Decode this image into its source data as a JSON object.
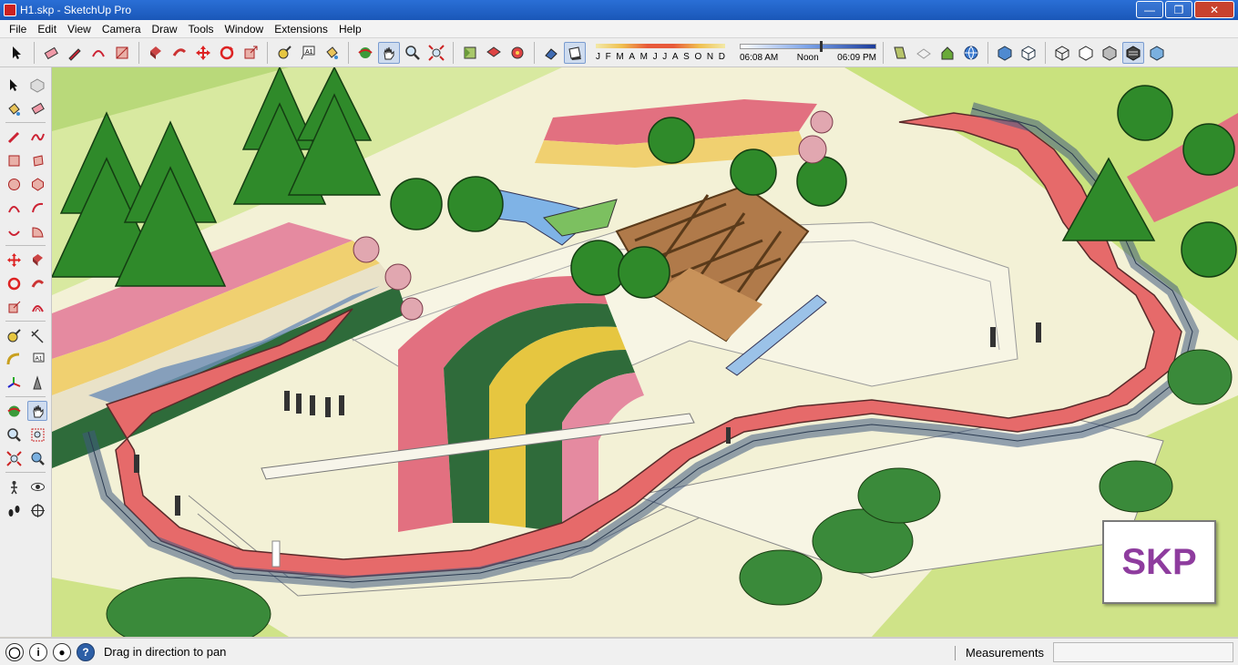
{
  "window": {
    "title": "H1.skp - SketchUp Pro",
    "controls": {
      "minimize": "—",
      "maximize": "❐",
      "close": "✕"
    }
  },
  "menu": {
    "items": [
      "File",
      "Edit",
      "View",
      "Camera",
      "Draw",
      "Tools",
      "Window",
      "Extensions",
      "Help"
    ]
  },
  "toolbar": {
    "icons": [
      "select-icon",
      "eraser-icon",
      "pencil-icon",
      "arc-icon",
      "rectangle-icon",
      "push-pull-icon",
      "follow-me-icon",
      "move-icon",
      "rotate-icon",
      "scale-icon",
      "tape-measure-icon",
      "text-icon",
      "paint-bucket-icon",
      "orbit-icon",
      "pan-icon",
      "zoom-icon",
      "zoom-extents-icon",
      "warehouse-icon",
      "extension-warehouse-icon",
      "components-icon",
      "shadows-icon",
      "shadow-settings-icon"
    ],
    "shadow": {
      "months": [
        "J",
        "F",
        "M",
        "A",
        "M",
        "J",
        "J",
        "A",
        "S",
        "O",
        "N",
        "D"
      ],
      "time_start": "06:08 AM",
      "time_mid": "Noon",
      "time_end": "06:09 PM"
    }
  },
  "status": {
    "message": "Drag in direction to pan",
    "help_glyph": "?",
    "info_glyph": "i",
    "measurements_label": "Measurements",
    "measurements_value": ""
  },
  "overlay": {
    "badge": "SKP"
  },
  "colors": {
    "walkway": "#e66a6a",
    "glass": "#6d8fb8",
    "grass": "#c9e27e",
    "plaza": "#f3f1d6",
    "tree": "#2f8a2a",
    "badge_text": "#8e3c9e"
  }
}
